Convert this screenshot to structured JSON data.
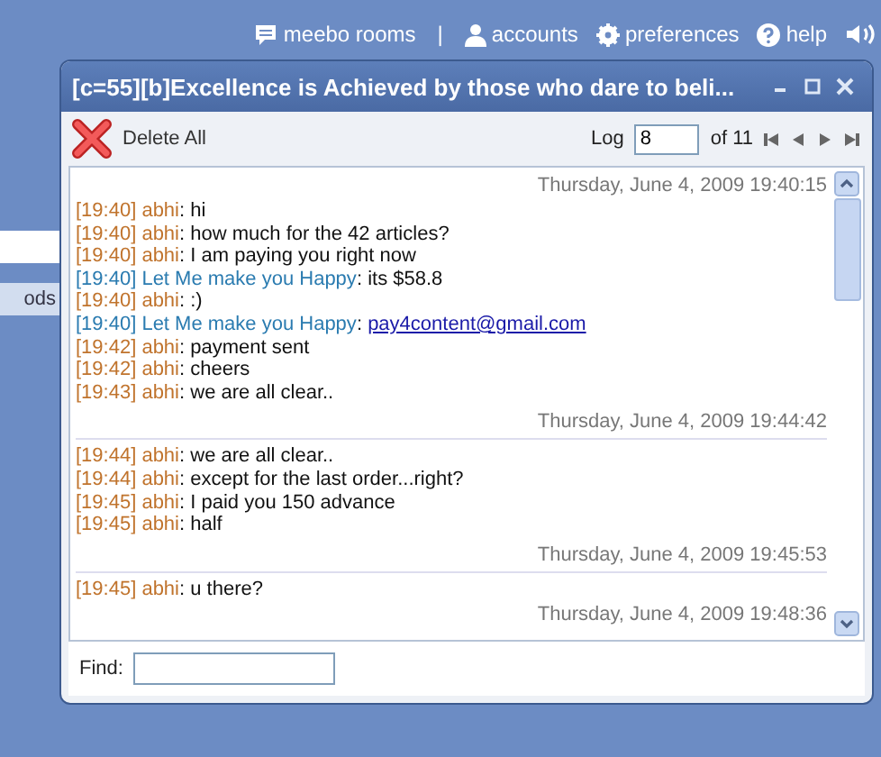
{
  "top_links": [
    {
      "kind": "rooms",
      "label": "meebo rooms"
    },
    {
      "kind": "separator",
      "label": "|"
    },
    {
      "kind": "accounts",
      "label": "accounts"
    },
    {
      "kind": "preferences",
      "label": "preferences"
    },
    {
      "kind": "help",
      "label": "help"
    },
    {
      "kind": "sound"
    }
  ],
  "sidebar": {
    "items": [
      {
        "label": "ods",
        "selected": false
      }
    ]
  },
  "window": {
    "title": "[c=55][b]Excellence is Achieved by those who dare to beli...",
    "toolbar": {
      "delete_label": "Delete All",
      "log_label": "Log",
      "log_value": "8",
      "log_total": "of 11"
    },
    "log": [
      {
        "kind": "date",
        "text": "Thursday, June 4, 2009 19:40:15"
      },
      {
        "kind": "message",
        "time": "[19:40]",
        "sender": "abhi",
        "sep": ":",
        "self": true,
        "link": false,
        "text": "hi"
      },
      {
        "kind": "message",
        "time": "[19:40]",
        "sender": "abhi",
        "sep": ":",
        "self": true,
        "link": false,
        "text": "how much for the 42 articles?"
      },
      {
        "kind": "message",
        "time": "[19:40]",
        "sender": "abhi",
        "sep": ":",
        "self": true,
        "link": false,
        "text": "I am paying you right now"
      },
      {
        "kind": "message",
        "time": "[19:40]",
        "sender": "Let Me make you Happy",
        "sep": ":",
        "self": false,
        "link": false,
        "text": "its $58.8"
      },
      {
        "kind": "message",
        "time": "[19:40]",
        "sender": "abhi",
        "sep": ":",
        "self": true,
        "link": false,
        "text": ":)"
      },
      {
        "kind": "message",
        "time": "[19:40]",
        "sender": "Let Me make you Happy",
        "sep": ":",
        "self": false,
        "link": true,
        "text": "pay4content@gmail.com"
      },
      {
        "kind": "message",
        "time": "[19:42]",
        "sender": "abhi",
        "sep": ":",
        "self": true,
        "link": false,
        "text": "payment sent"
      },
      {
        "kind": "message",
        "time": "[19:42]",
        "sender": "abhi",
        "sep": ":",
        "self": true,
        "link": false,
        "text": "cheers"
      },
      {
        "kind": "message",
        "time": "[19:43]",
        "sender": "abhi",
        "sep": ":",
        "self": true,
        "link": false,
        "text": "we are all clear.."
      },
      {
        "kind": "date",
        "text": "Thursday, June 4, 2009 19:44:42"
      },
      {
        "kind": "message",
        "time": "[19:44]",
        "sender": "abhi",
        "sep": ":",
        "self": true,
        "link": false,
        "text": "we are all clear.."
      },
      {
        "kind": "message",
        "time": "[19:44]",
        "sender": "abhi",
        "sep": ":",
        "self": true,
        "link": false,
        "text": "except for the last order...right?"
      },
      {
        "kind": "message",
        "time": "[19:45]",
        "sender": "abhi",
        "sep": ":",
        "self": true,
        "link": false,
        "text": "I paid you 150 advance"
      },
      {
        "kind": "message",
        "time": "[19:45]",
        "sender": "abhi",
        "sep": ":",
        "self": true,
        "link": false,
        "text": "half"
      },
      {
        "kind": "date",
        "text": "Thursday, June 4, 2009 19:45:53"
      },
      {
        "kind": "message",
        "time": "[19:45]",
        "sender": "abhi",
        "sep": ":",
        "self": true,
        "link": false,
        "text": "u there?"
      },
      {
        "kind": "date",
        "text": "Thursday, June 4, 2009 19:48:36"
      }
    ],
    "find": {
      "label": "Find:"
    }
  }
}
